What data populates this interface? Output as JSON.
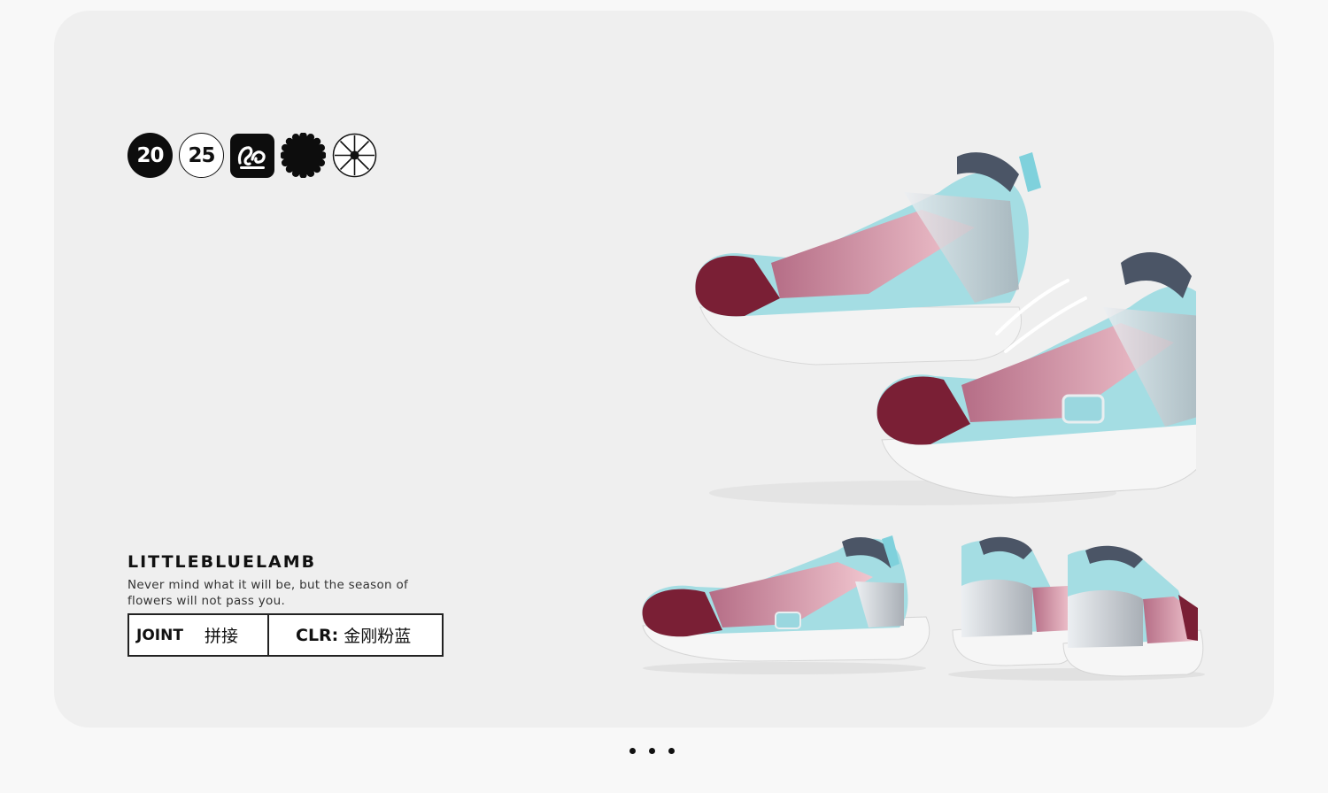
{
  "badges": [
    "20",
    "25"
  ],
  "badge_icons": [
    "lamb-logo-icon",
    "flower-badge-icon",
    "snowflake-badge-icon"
  ],
  "brand": {
    "name": "LITTLEBLUELAMB"
  },
  "tagline": "Never mind what it will be, but the season of flowers will not pass you.",
  "spec": {
    "joint_label": "JOINT",
    "joint_value": "拼接",
    "color_label": "CLR:",
    "color_value": "金刚粉蓝"
  },
  "colors": {
    "card_bg": "#efefef",
    "burgundy": "#7a1f35",
    "pink": "#d99aab",
    "aqua": "#8fd6df",
    "silver": "#c9cdd2",
    "sole": "#f4f4f4"
  },
  "pager": {
    "count": 3
  }
}
